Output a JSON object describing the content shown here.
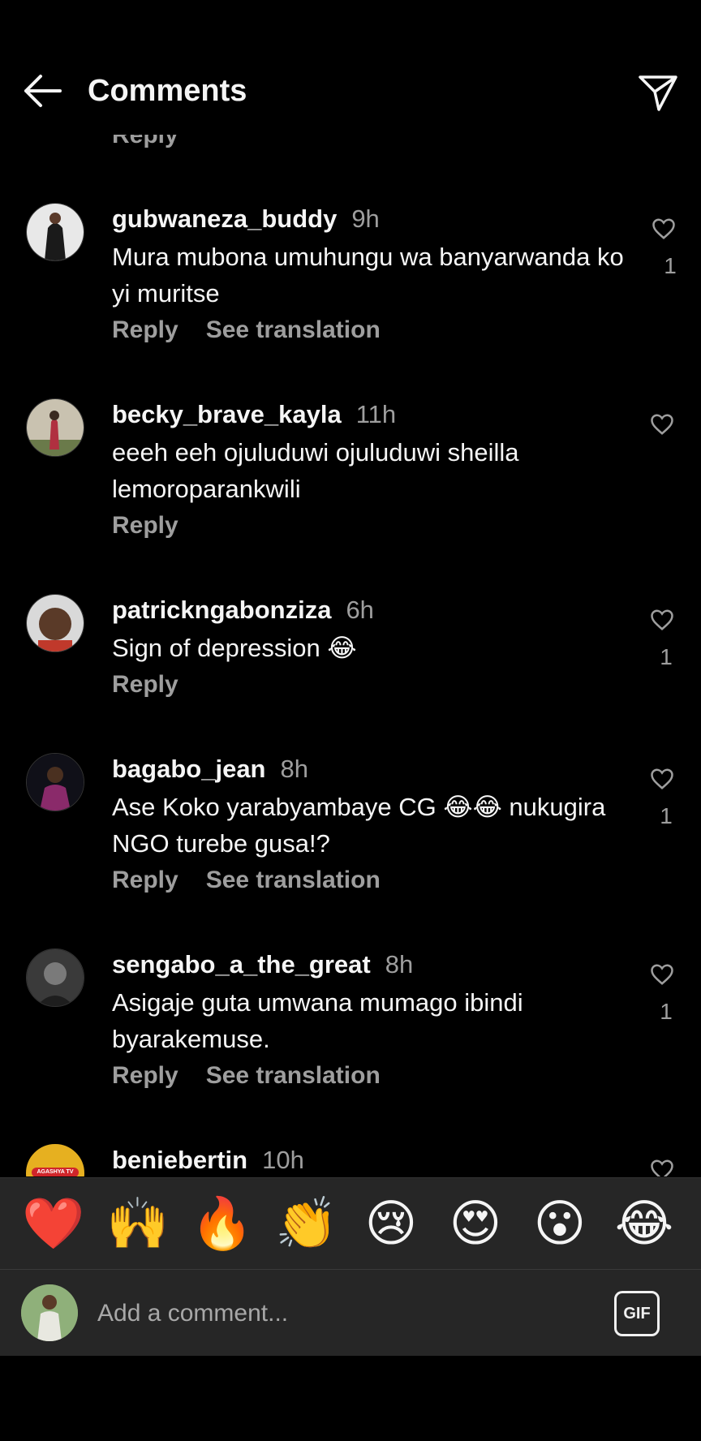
{
  "header": {
    "title": "Comments"
  },
  "top_partial_reply": "Reply",
  "comments": [
    {
      "username": "gubwaneza_buddy",
      "time": "9h",
      "text": "Mura mubona umuhungu wa banyarwanda ko yi muritse",
      "reply": "Reply",
      "translate": "See translation",
      "likes": "1"
    },
    {
      "username": "becky_brave_kayla",
      "time": "11h",
      "text": "eeeh eeh ojuluduwi ojuluduwi sheilla lemoroparankwili",
      "reply": "Reply",
      "translate": "",
      "likes": ""
    },
    {
      "username": "patrickngabonziza",
      "time": "6h",
      "text": "Sign of depression 😂",
      "reply": "Reply",
      "translate": "",
      "likes": "1"
    },
    {
      "username": "bagabo_jean",
      "time": "8h",
      "text": "Ase Koko yarabyambaye CG 😂😂 nukugira NGO turebe  gusa!?",
      "reply": "Reply",
      "translate": "See translation",
      "likes": "1"
    },
    {
      "username": "sengabo_a_the_great",
      "time": "8h",
      "text": "Asigaje guta umwana mumago ibindi byarakemuse.",
      "reply": "Reply",
      "translate": "See translation",
      "likes": "1"
    },
    {
      "username": "beniebertin",
      "time": "10h",
      "text": "",
      "reply": "",
      "translate": "",
      "likes": ""
    }
  ],
  "avatar_badge_text": "AGASHYA TV",
  "emoji_bar": [
    "❤️",
    "🙌",
    "🔥",
    "👏",
    "😢",
    "😍",
    "😮",
    "😂"
  ],
  "composer": {
    "placeholder": "Add a comment...",
    "gif_label": "GIF"
  },
  "colors": {
    "background": "#000000",
    "secondary_text": "#9e9e9e",
    "bar": "#262626"
  }
}
